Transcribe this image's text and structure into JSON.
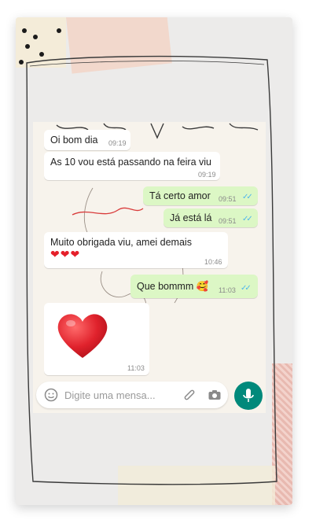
{
  "messages": [
    {
      "dir": "in",
      "text": "Oi bom dia",
      "time": "09:19"
    },
    {
      "dir": "in",
      "text": "As 10 vou está passando na feira viu",
      "time": "09:19"
    },
    {
      "dir": "out",
      "text": "Tá certo amor",
      "time": "09:51"
    },
    {
      "dir": "out",
      "text": "Já está lá",
      "time": "09:51"
    },
    {
      "dir": "in",
      "text": "Muito obrigada viu, amei demais",
      "emoji": "❤❤❤",
      "time": "10:46"
    },
    {
      "dir": "out",
      "text": "Que bommm 🥰",
      "time": "11:03"
    },
    {
      "dir": "in",
      "sticker": "red-heart",
      "time": "11:03"
    }
  ],
  "input": {
    "placeholder": "Digite uma mensa..."
  },
  "icons": [
    "emoji-icon",
    "attach-icon",
    "camera-icon",
    "microphone-icon"
  ],
  "colors": {
    "outgoing": "#dcf7c5",
    "incoming": "#ffffff",
    "accent": "#00897b",
    "ticks": "#4fb6ec",
    "heart": "#e5202a"
  }
}
